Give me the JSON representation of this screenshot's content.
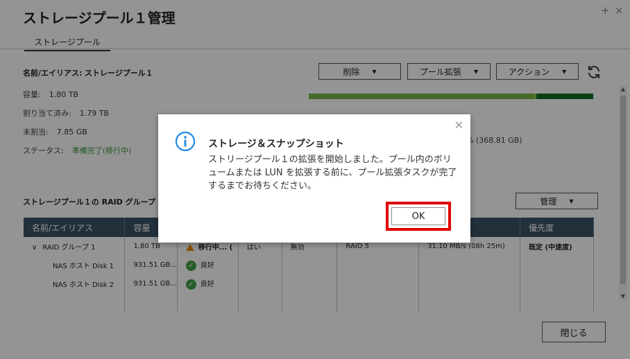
{
  "window": {
    "title": "ストレージプール１管理",
    "controls": [
      "+",
      "×"
    ]
  },
  "tabs": [
    {
      "label": "ストレージプール"
    }
  ],
  "pool_info": {
    "name_label": "名前/エイリアス:",
    "name_value": "ストレージプール１",
    "capacity_label": "容量:",
    "capacity_value": "1.80 TB",
    "allocated_label": "割り当て済み:",
    "allocated_value": "1.79 TB",
    "unallocated_label": "未割当:",
    "unallocated_value": "7.85 GB",
    "status_label": "ステータス:",
    "status_value": "準備完了(移行中)",
    "partial_stat": "% (368.81 GB)"
  },
  "usage_bar": {
    "used_fraction": 0.79,
    "reserved_fraction": 0.2,
    "colors": {
      "used": "#7ab648",
      "reserved": "#146b1c",
      "free": "#8dc63f"
    }
  },
  "toolbar": {
    "delete_label": "削除",
    "expand_label": "プール拡張",
    "action_label": "アクション",
    "refresh_icon": "refresh-icon"
  },
  "raid_section": {
    "title": "ストレージプール１の RAID グループ",
    "manage_label": "管理"
  },
  "table": {
    "columns": [
      "名前/エイリアス",
      "容量",
      "",
      "",
      "",
      "",
      "",
      "優先度"
    ],
    "rows": [
      {
        "name": "RAID グループ 1",
        "capacity": "1.80 TB",
        "status": "移行中... (",
        "c3": "はい",
        "c4": "無効",
        "c5": "RAID 5",
        "c6": "31.10 MB/s (08h 25m)",
        "priority": "既定 (中速度)"
      },
      {
        "name": "NAS ホスト Disk 1",
        "capacity": "931.51 GB...",
        "status": "良好"
      },
      {
        "name": "NAS ホスト Disk 2",
        "capacity": "931.51 GB...",
        "status": "良好"
      }
    ]
  },
  "footer": {
    "close_label": "閉じる"
  },
  "dialog": {
    "title": "ストレージ＆スナップショット",
    "message": "ストリージプール１の拡張を開始しました。プール内のボリュームまたは LUN を拡張する前に、プール拡張タスクが完了するまでお待ちください。",
    "ok_label": "OK",
    "highlight_color": "#e00000"
  }
}
